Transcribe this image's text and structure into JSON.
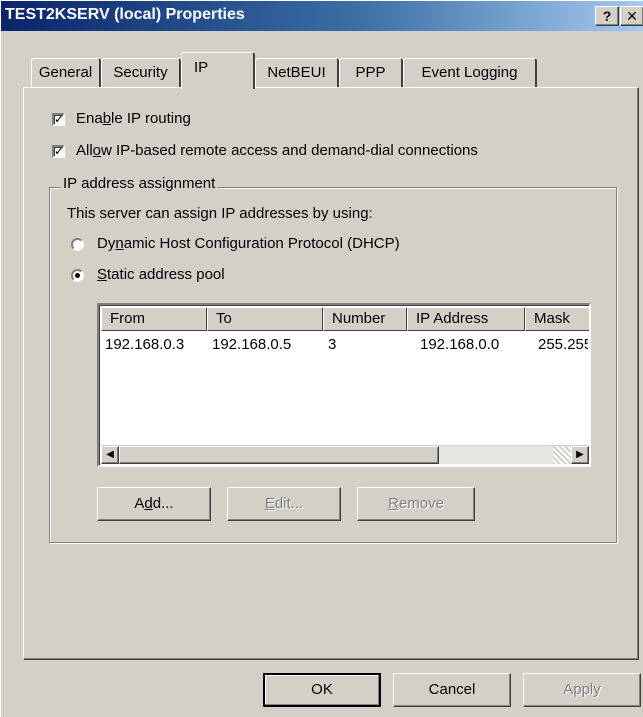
{
  "window": {
    "title": "TEST2KSERV (local) Properties",
    "help_button": "?",
    "close_button": "✕"
  },
  "tabs": [
    {
      "label": "General",
      "active": false
    },
    {
      "label": "Security",
      "active": false
    },
    {
      "label": "IP",
      "active": true
    },
    {
      "label": "NetBEUI",
      "active": false
    },
    {
      "label": "PPP",
      "active": false
    },
    {
      "label": "Event Logging",
      "active": false
    }
  ],
  "options": {
    "enable_ip_routing": {
      "label_pre": "Ena",
      "label_accel": "b",
      "label_post": "le IP routing",
      "checked": true
    },
    "allow_ip_remote": {
      "label_pre": "All",
      "label_accel": "o",
      "label_post": "w IP-based remote access and demand-dial connections",
      "checked": true
    }
  },
  "ip_assignment": {
    "group_title": "IP address assignment",
    "description": "This server can assign IP addresses by using:",
    "dhcp": {
      "label_pre": "Dy",
      "label_accel": "n",
      "label_post": "amic Host Configuration Protocol (DHCP)",
      "selected": false
    },
    "static": {
      "label_pre": "",
      "label_accel": "S",
      "label_post": "tatic address pool",
      "selected": true
    }
  },
  "pool_table": {
    "columns": [
      "From",
      "To",
      "Number",
      "IP Address",
      "Mask"
    ],
    "rows": [
      [
        "192.168.0.3",
        "192.168.0.5",
        "3",
        "192.168.0.0",
        "255.255"
      ]
    ]
  },
  "pool_buttons": {
    "add": {
      "pre": "A",
      "accel": "d",
      "post": "d..."
    },
    "edit": {
      "pre": "",
      "accel": "E",
      "post": "dit..."
    },
    "remove": {
      "pre": "",
      "accel": "R",
      "post": "emove"
    }
  },
  "dialog_buttons": {
    "ok": "OK",
    "cancel": "Cancel",
    "apply": "Apply"
  }
}
